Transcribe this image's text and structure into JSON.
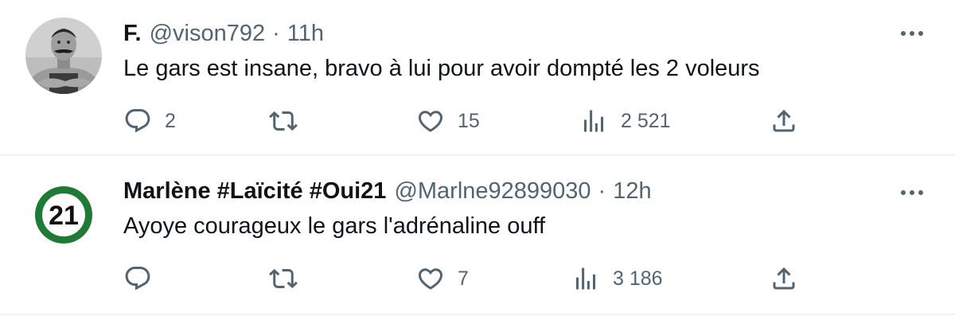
{
  "tweets": [
    {
      "display_name": "F.",
      "handle": "@vison792",
      "separator": "·",
      "time": "11h",
      "text": "Le gars est insane, bravo à lui pour avoir dompté les 2 voleurs",
      "avatar": "vintage-strongman-photo",
      "counts": {
        "replies": "2",
        "retweets": "",
        "likes": "15",
        "views": "2 521"
      }
    },
    {
      "display_name": "Marlène #Laïcité #Oui21",
      "handle": "@Marlne92899030",
      "separator": "·",
      "time": "12h",
      "text": "Ayoye courageux le gars l'adrénaline ouff",
      "avatar": "number-21-badge",
      "avatar_text": "21",
      "avatar_colors": {
        "ring": "#1e7a34",
        "inner": "#ffffff",
        "text": "#111111"
      },
      "counts": {
        "replies": "",
        "retweets": "",
        "likes": "7",
        "views": "3 186"
      }
    }
  ],
  "icons": [
    "reply-icon",
    "retweet-icon",
    "like-icon",
    "views-icon",
    "share-icon",
    "more-icon"
  ],
  "colors": {
    "text": "#0f1419",
    "secondary": "#536471",
    "divider": "#eff3f4"
  }
}
